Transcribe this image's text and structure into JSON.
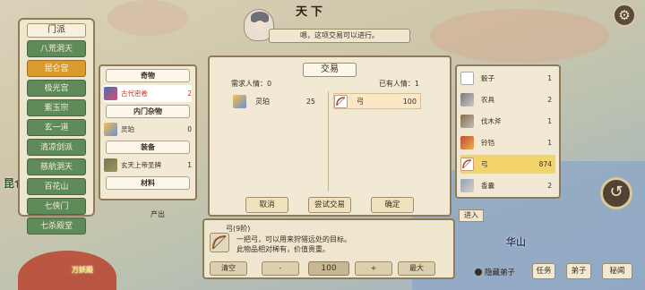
{
  "map": {
    "title": "天下",
    "labels": [
      "昆仑",
      "华山",
      "万妖殿"
    ]
  },
  "npc": {
    "speech": "嗯，这项交易可以进行。"
  },
  "sect_panel": {
    "header": "门派",
    "items": [
      "八荒洞天",
      "昆仑宫",
      "极光宫",
      "紫玉宗",
      "玄一道",
      "清凉剑派",
      "慈航洞天",
      "百花山",
      "七侠门",
      "七杀殿堂"
    ],
    "active_index": 1
  },
  "items_panel": {
    "categories": [
      {
        "name": "奇物",
        "rows": [
          {
            "name": "古代密卷",
            "qty": "2",
            "selected": true,
            "red": true
          }
        ]
      },
      {
        "name": "内门杂物",
        "rows": [
          {
            "name": "灵珀",
            "qty": "0"
          }
        ]
      },
      {
        "name": "装备",
        "rows": [
          {
            "name": "玄天上帝圣牌",
            "qty": "1"
          }
        ]
      },
      {
        "name": "材料",
        "rows": []
      }
    ]
  },
  "trade": {
    "title": "交易",
    "need_label": "需求人情：0",
    "have_label": "已有人情：1",
    "offer_left": {
      "name": "灵珀",
      "value": "25"
    },
    "offer_right": {
      "name": "弓",
      "value": "100"
    },
    "buttons": {
      "cancel": "取消",
      "try": "尝试交易",
      "confirm": "确定"
    }
  },
  "inventory": {
    "rows": [
      {
        "name": "骰子",
        "qty": "1"
      },
      {
        "name": "农具",
        "qty": "2"
      },
      {
        "name": "伐木斧",
        "qty": "1"
      },
      {
        "name": "铃铛",
        "qty": "1"
      },
      {
        "name": "弓",
        "qty": "874",
        "selected": true
      },
      {
        "name": "香囊",
        "qty": "2"
      }
    ]
  },
  "detail": {
    "title": "弓(9阶)",
    "line1": "一把弓，可以用来狩猎远处的目标。",
    "line2": "此物品相对稀有，价值贵重。",
    "clear": "清空",
    "minus": "-",
    "qty": "100",
    "plus": "+",
    "max": "最大"
  },
  "bottom": {
    "hide_disciple": "隐藏弟子",
    "tasks": "任务",
    "disciples": "弟子",
    "secrets": "秘闻",
    "enter": "进入",
    "produce": "产出"
  },
  "colors": {
    "panel": "#f1e9d3",
    "sect_green": "#5f8a5a",
    "sect_active": "#d99b2b",
    "selected": "#f2d46b"
  }
}
